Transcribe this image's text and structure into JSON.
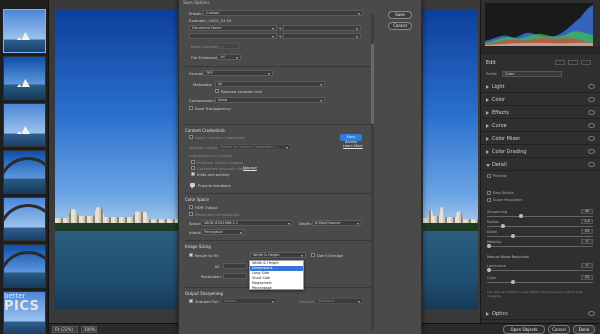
{
  "filmstrip": {
    "thumb_count": 7
  },
  "watermark": {
    "top": "better",
    "big": "PICS"
  },
  "statusbar": {
    "fit_label": "Fit (22%)",
    "zoom": "100%",
    "info_text": "Adobe RGB (1998) · 16 bit · 3024 by 4032 (12.2MP) · 240 ppi",
    "open_objects": "Open Objects",
    "cancel": "Cancel",
    "done": "Done"
  },
  "right_panel": {
    "edit_label": "Edit",
    "profile_label": "Profile",
    "profile_value": "Color",
    "sections": [
      {
        "label": "Light",
        "open": false
      },
      {
        "label": "Color",
        "open": false
      },
      {
        "label": "Effects",
        "open": false
      },
      {
        "label": "Curve",
        "open": false
      },
      {
        "label": "Color Mixer",
        "open": false
      },
      {
        "label": "Color Grading",
        "open": false
      },
      {
        "label": "Detail",
        "open": true
      }
    ],
    "detail": {
      "preview": "Preview",
      "raw_details": "Raw Details",
      "super_resolution": "Super Resolution",
      "sharpening": {
        "label": "Sharpening",
        "value": "40"
      },
      "radius": {
        "label": "Radius",
        "value": "1.0"
      },
      "detail": {
        "label": "Detail",
        "value": "25"
      },
      "masking": {
        "label": "Masking",
        "value": "0"
      },
      "nr_head": "Manual Noise Reduction",
      "luminance": {
        "label": "Luminance",
        "value": "0"
      },
      "color": {
        "label": "Color",
        "value": "25"
      },
      "tooltip": "Tip: Hold Alt (Option) to see effects of sharpening controls while dragging.",
      "optics": "Optics"
    },
    "histogram_colors": {
      "red": "#e0443a",
      "green": "#3fc24a",
      "blue": "#3d7ef5",
      "white": "#d9d9d9"
    }
  },
  "dialog": {
    "title": "Save Options",
    "save": "Save",
    "cancel": "Cancel",
    "preset_label": "Preset:",
    "preset_value": "Custom",
    "example_label": "Example:",
    "example_value": "_G001_01.tif",
    "docname_value": "Document Name",
    "begin_numbering": "Begin Numbering:",
    "file_ext_label": "File Extension:",
    "file_ext_value": ".tif",
    "format_label": "Format:",
    "format_value": "TIFF",
    "metadata_label": "Metadata:",
    "metadata_value": "All",
    "remove_location": "Remove Location Info",
    "compression_label": "Compression:",
    "compression_value": "None",
    "save_transparency": "Save Transparency",
    "content_credentials_head": "Content Credentials",
    "apply_cc": "Apply Content Credentials",
    "early_access": "Early Access",
    "learn_more": "Learn More",
    "storage_label": "Storage method:",
    "storage_value": "Publish to Content Credentials C...",
    "info_include": "Information to include:",
    "producer": "Producer (Denis Google)",
    "connected_accounts": "Connected accounts (Beta)",
    "manage": "Manage",
    "edits_activity": "Edits and activity",
    "provide_feedback": "Provide feedback",
    "color_space_head": "Color Space",
    "hdr_output": "HDR Output",
    "max_compat": "Maximize Compatibility",
    "space_label": "Space:",
    "space_value": "sRGB IEC61966-2.1",
    "depth_label": "Depth:",
    "depth_value": "8 Bits/Channel",
    "intent_label": "Intent:",
    "intent_value": "Perceptual",
    "image_sizing_head": "Image Sizing",
    "resize_to_fit": "Resize to Fit:",
    "resize_value": "Width & Height",
    "dont_enlarge": "Don't Enlarge",
    "w_label": "W:",
    "resolution_label": "Resolution:",
    "output_sharpening_head": "Output Sharpening",
    "sharpen_for": "Sharpen For:",
    "sharpen_value": "Screen",
    "amount_label": "Amount:",
    "amount_value": "Standard",
    "dropdown": [
      "Width & Height",
      "Dimensions",
      "Long Side",
      "Short Side",
      "Megapixels",
      "Percentage"
    ],
    "dropdown_highlight_index": 1
  }
}
